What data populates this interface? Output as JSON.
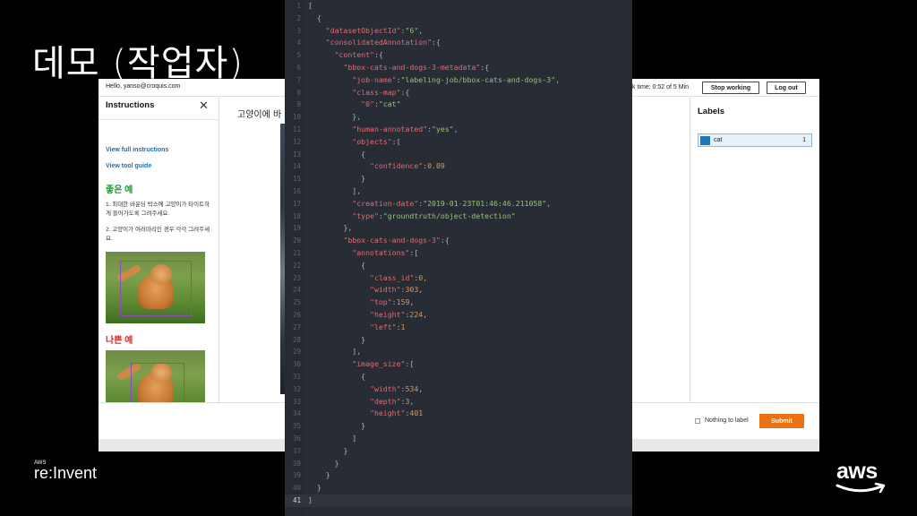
{
  "slide": {
    "title": "데모 (작업자)"
  },
  "topbar": {
    "hello": "Hello, yanso@croquis.com",
    "task_time": "k time: 0:52 of 5 Min",
    "stop_label": "Stop working",
    "logout_label": "Log out"
  },
  "instructions": {
    "title": "Instructions",
    "close_icon": "close-icon",
    "full_link": "View full instructions",
    "tool_link": "View tool guide",
    "good_heading": "좋은 예",
    "text1": "1. 최대한 바운딩 박스에 고양이가 타이트하게 들어가도록 그려주세요.",
    "text2": "2. 고양이가 여러마리인 경우 각각 그려주세요.",
    "bad_heading": "나쁜 예"
  },
  "main": {
    "label": "고양이에 바"
  },
  "labels_panel": {
    "title": "Labels",
    "items": [
      {
        "name": "cat",
        "count": "1",
        "color": "#1f77b4"
      }
    ]
  },
  "footer": {
    "nothing_label": "Nothing to label",
    "submit_label": "Submit"
  },
  "editor": {
    "active_line": 41,
    "lines": [
      "[",
      "  {",
      "    \"datasetObjectId\":\"6\",",
      "    \"consolidatedAnnotation\":{",
      "      \"content\":{",
      "        \"bbox-cats-and-dogs-3-metadata\":{",
      "          \"job-name\":\"labeling-job/bbox-cats-and-dogs-3\",",
      "          \"class-map\":{",
      "            \"0\":\"cat\"",
      "          },",
      "          \"human-annotated\":\"yes\",",
      "          \"objects\":[",
      "            {",
      "              \"confidence\":0.09",
      "            }",
      "          ],",
      "          \"creation-date\":\"2019-01-23T01:46:46.211058\",",
      "          \"type\":\"groundtruth/object-detection\"",
      "        },",
      "        \"bbox-cats-and-dogs-3\":{",
      "          \"annotations\":[",
      "            {",
      "              \"class_id\":0,",
      "              \"width\":303,",
      "              \"top\":159,",
      "              \"height\":224,",
      "              \"left\":1",
      "            }",
      "          ],",
      "          \"image_size\":[",
      "            {",
      "              \"width\":534,",
      "              \"depth\":3,",
      "              \"height\":401",
      "            }",
      "          ]",
      "        }",
      "      }",
      "    }",
      "  }",
      "]"
    ]
  },
  "branding": {
    "aws_small": "AWS",
    "reinvent": "re:Invent",
    "aws_logo": "aws"
  }
}
